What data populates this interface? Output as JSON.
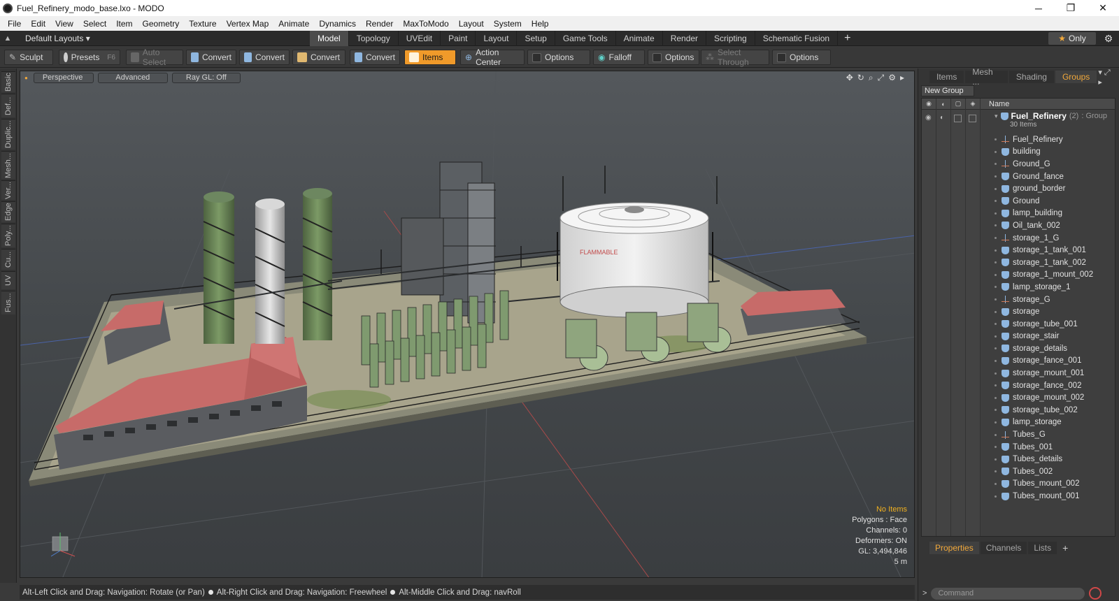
{
  "window": {
    "title": "Fuel_Refinery_modo_base.lxo - MODO",
    "minimize": "─",
    "maximize": "❐",
    "close": "✕"
  },
  "menubar": [
    "File",
    "Edit",
    "View",
    "Select",
    "Item",
    "Geometry",
    "Texture",
    "Vertex Map",
    "Animate",
    "Dynamics",
    "Render",
    "MaxToModo",
    "Layout",
    "System",
    "Help"
  ],
  "layoutbar": {
    "layout_select": "Default Layouts ▾",
    "tabs": [
      "Model",
      "Topology",
      "UVEdit",
      "Paint",
      "Layout",
      "Setup",
      "Game Tools",
      "Animate",
      "Render",
      "Scripting",
      "Schematic Fusion"
    ],
    "active_tab": "Model",
    "add": "+",
    "only_label": "Only",
    "only_icon": "★",
    "gear_icon": "⚙"
  },
  "toolbar": {
    "sculpt": "Sculpt",
    "presets": "Presets",
    "presets_key": "F6",
    "auto_select": "Auto Select",
    "convert_1": "Convert",
    "convert_2": "Convert",
    "convert_3": "Convert",
    "convert_4": "Convert",
    "items": "Items",
    "action_center": "Action Center",
    "options_1": "Options",
    "falloff": "Falloff",
    "options_2": "Options",
    "select_through": "Select Through",
    "options_3": "Options"
  },
  "leftstrip": [
    "Basic",
    "Def...",
    "Duplic...",
    "Mesh...",
    "Ver...",
    "Edge",
    "Poly...",
    "Cu...",
    "UV",
    "Fus..."
  ],
  "viewport": {
    "view_mode": "Perspective",
    "shading": "Advanced",
    "raygl": "Ray GL: Off",
    "tools": [
      "✥",
      "↻",
      "⌕",
      "⤢",
      "⚙",
      "▸"
    ],
    "info": {
      "no_items": "No Items",
      "polygons": "Polygons : Face",
      "channels": "Channels: 0",
      "deformers": "Deformers: ON",
      "gl": "GL: 3,494,846",
      "scale": "5 m"
    },
    "tank_text": "FLAMMABLE"
  },
  "statusbar": {
    "hint_1": "Alt-Left Click and Drag: Navigation: Rotate (or Pan)",
    "hint_2": "Alt-Right Click and Drag: Navigation: Freewheel",
    "hint_3": "Alt-Middle Click and Drag: navRoll"
  },
  "rightpanel": {
    "tabs": [
      "Items",
      "Mesh ...",
      "Shading",
      "Groups"
    ],
    "active_tab": "Groups",
    "new_group": "New Group",
    "header_name": "Name",
    "root": {
      "name": "Fuel_Refinery",
      "count": "(2)",
      "type": ": Group",
      "sub": "30 Items"
    },
    "items": [
      {
        "name": "Fuel_Refinery",
        "kind": "locator"
      },
      {
        "name": "building",
        "kind": "mesh"
      },
      {
        "name": "Ground_G",
        "kind": "locator"
      },
      {
        "name": "Ground_fance",
        "kind": "mesh"
      },
      {
        "name": "ground_border",
        "kind": "mesh"
      },
      {
        "name": "Ground",
        "kind": "mesh"
      },
      {
        "name": "lamp_building",
        "kind": "mesh"
      },
      {
        "name": "Oil_tank_002",
        "kind": "mesh"
      },
      {
        "name": "storage_1_G",
        "kind": "locator"
      },
      {
        "name": "storage_1_tank_001",
        "kind": "mesh"
      },
      {
        "name": "storage_1_tank_002",
        "kind": "mesh"
      },
      {
        "name": "storage_1_mount_002",
        "kind": "mesh"
      },
      {
        "name": "lamp_storage_1",
        "kind": "mesh"
      },
      {
        "name": "storage_G",
        "kind": "locator"
      },
      {
        "name": "storage",
        "kind": "mesh"
      },
      {
        "name": "storage_tube_001",
        "kind": "mesh"
      },
      {
        "name": "storage_stair",
        "kind": "mesh"
      },
      {
        "name": "storage_details",
        "kind": "mesh"
      },
      {
        "name": "storage_fance_001",
        "kind": "mesh"
      },
      {
        "name": "storage_mount_001",
        "kind": "mesh"
      },
      {
        "name": "storage_fance_002",
        "kind": "mesh"
      },
      {
        "name": "storage_mount_002",
        "kind": "mesh"
      },
      {
        "name": "storage_tube_002",
        "kind": "mesh"
      },
      {
        "name": "lamp_storage",
        "kind": "mesh"
      },
      {
        "name": "Tubes_G",
        "kind": "locator"
      },
      {
        "name": "Tubes_001",
        "kind": "mesh"
      },
      {
        "name": "Tubes_details",
        "kind": "mesh"
      },
      {
        "name": "Tubes_002",
        "kind": "mesh"
      },
      {
        "name": "Tubes_mount_002",
        "kind": "mesh"
      },
      {
        "name": "Tubes_mount_001",
        "kind": "mesh"
      }
    ],
    "bottom_tabs": [
      "Properties",
      "Channels",
      "Lists"
    ],
    "bottom_active": "Properties",
    "bottom_add": "+",
    "command_placeholder": "Command"
  },
  "colors": {
    "accent": "#f09a2a",
    "viewport_bg": "#46494c",
    "roof": "#c96a68",
    "tank": "#e8e8e8",
    "column_green": "#6f8a5a"
  }
}
